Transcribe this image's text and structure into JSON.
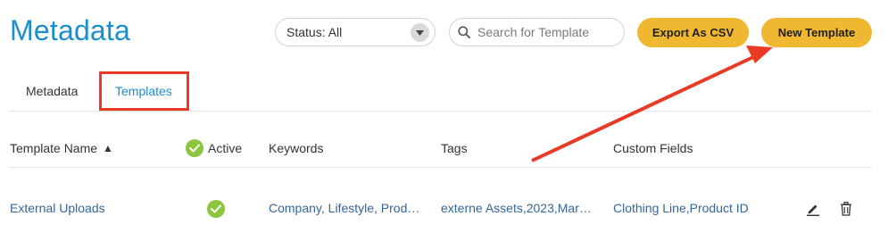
{
  "header": {
    "title": "Metadata",
    "status_filter": "Status: All",
    "search_placeholder": "Search for Template",
    "export_label": "Export As CSV",
    "new_label": "New Template"
  },
  "tabs": [
    {
      "label": "Metadata",
      "active": false
    },
    {
      "label": "Templates",
      "active": true
    }
  ],
  "table": {
    "columns": {
      "name": "Template Name",
      "active": "Active",
      "keywords": "Keywords",
      "tags": "Tags",
      "custom_fields": "Custom Fields"
    },
    "sort_indicator": "▲",
    "rows": [
      {
        "name": "External Uploads",
        "active": true,
        "keywords": "Company, Lifestyle, Prod…",
        "tags": "externe Assets,2023,Mar…",
        "custom_fields": "Clothing Line,Product ID"
      }
    ]
  },
  "colors": {
    "title": "#1a8fd0",
    "button": "#f0b731",
    "active_check": "#8cc63f",
    "annotation": "#e83a24",
    "link_text": "#35669a"
  },
  "icons": [
    "chevron-down-icon",
    "search-icon",
    "check-circle-icon",
    "edit-pencil-icon",
    "trash-icon"
  ]
}
